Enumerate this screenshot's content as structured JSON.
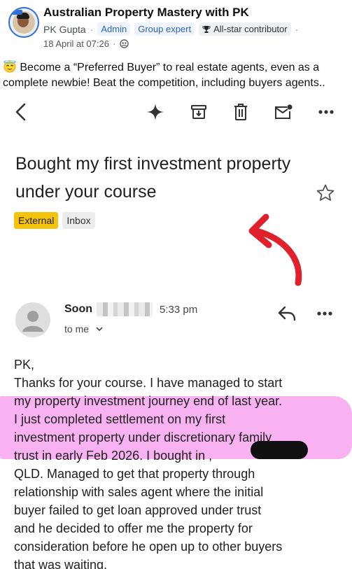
{
  "post": {
    "group_name": "Australian Property Mastery with PK",
    "poster": "PK Gupta",
    "separator": "·",
    "badges": [
      "Admin",
      "Group expert",
      "All-star contributor"
    ],
    "date": "18 April at 07:26",
    "text": "😇 Become a “Preferred Buyer” to real estate agents, even as a complete newbie! Beat the competition, including buyers agents.."
  },
  "email": {
    "subject": "Bought my first investment property under your course",
    "labels": [
      "External",
      "Inbox"
    ],
    "sender_name": "Soon",
    "time": "5:33 pm",
    "to": "to me",
    "body_lines": [
      "PK,",
      " Thanks for your course. I have managed to start",
      "my property investment journey end of last year.",
      "I just completed settlement on my first",
      "investment property under discretionary family",
      "trust in early Feb 2026. I bought in ,",
      "QLD. Managed to get that property through",
      "relationship with sales agent where the initial",
      "buyer failed to get loan approved under trust",
      "and he decided to offer me the property for",
      "consideration before he open up to other buyers",
      "that was waiting."
    ]
  },
  "icons": {
    "toolbar": [
      "back-icon",
      "sparkle-icon",
      "archive-icon",
      "delete-icon",
      "mark-unread-icon",
      "more-icon"
    ],
    "star": "star-icon",
    "reply": "reply-icon",
    "annotation": "red-arrow"
  },
  "colors": {
    "highlight": "#f272e6",
    "external_label": "#f5c20c",
    "arrow": "#e0202a",
    "admin_tag": "#2f63c0"
  }
}
